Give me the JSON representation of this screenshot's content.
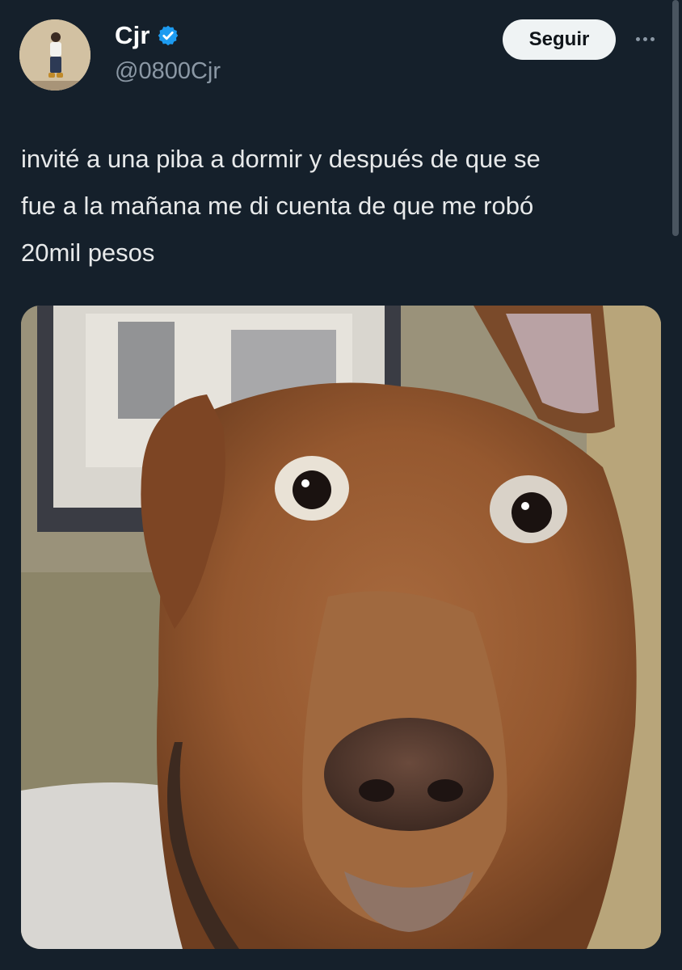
{
  "author": {
    "display_name": "Cjr",
    "handle": "@0800Cjr",
    "verified": true,
    "avatar": "avatar-photo"
  },
  "actions": {
    "follow_label": "Seguir",
    "more_icon": "more-horizontal-icon"
  },
  "tweet": {
    "text_lines": [
      "invité a una piba a dormir y después de que se",
      "fue a la mañana me di cuenta de que me robó",
      "20mil pesos"
    ]
  },
  "media": {
    "kind": "image",
    "subject": "dog-photo"
  },
  "colors": {
    "background": "#15202b",
    "text_primary": "#e7e9ea",
    "text_secondary": "#8b98a5",
    "verified_blue": "#1d9bf0",
    "button_bg": "#eff3f4"
  }
}
